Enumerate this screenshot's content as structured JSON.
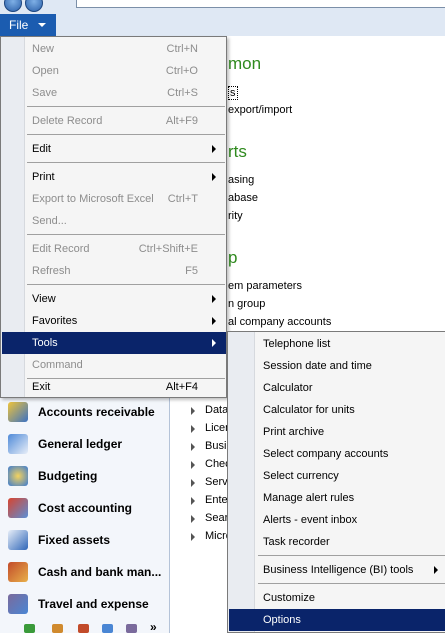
{
  "file_button": {
    "label": "File"
  },
  "background": {
    "headings": [
      "mon",
      "rts",
      "p"
    ],
    "lines": [
      "s",
      "export/import",
      "asing",
      "abase",
      "rity",
      "em parameters",
      "n group",
      "al company accounts"
    ]
  },
  "nav_pane": {
    "items": [
      {
        "label": "Accounts receivable",
        "icon": "accounts-receivable-icon"
      },
      {
        "label": "General ledger",
        "icon": "general-ledger-icon"
      },
      {
        "label": "Budgeting",
        "icon": "budgeting-icon"
      },
      {
        "label": "Cost accounting",
        "icon": "cost-accounting-icon"
      },
      {
        "label": "Fixed assets",
        "icon": "fixed-assets-icon"
      },
      {
        "label": "Cash and bank man...",
        "icon": "cash-and-bank-icon"
      },
      {
        "label": "Travel and expense",
        "icon": "travel-and-expense-icon"
      }
    ],
    "more_glyph": "»"
  },
  "secondary_list": [
    "Data",
    "Licen",
    "Busin",
    "Chec",
    "Serv",
    "Ente",
    "Sear",
    "Micro"
  ],
  "file_menu": {
    "items": [
      {
        "label": "New",
        "shortcut": "Ctrl+N",
        "disabled": true
      },
      {
        "label": "Open",
        "shortcut": "Ctrl+O",
        "disabled": true
      },
      {
        "label": "Save",
        "shortcut": "Ctrl+S",
        "disabled": true
      },
      {
        "label": "Delete Record",
        "shortcut": "Alt+F9",
        "disabled": true
      },
      {
        "label": "Edit",
        "shortcut": "",
        "disabled": false,
        "submenu": true
      },
      {
        "label": "Print",
        "shortcut": "",
        "disabled": false,
        "submenu": true
      },
      {
        "label": "Export to Microsoft Excel",
        "shortcut": "Ctrl+T",
        "disabled": true
      },
      {
        "label": "Send...",
        "shortcut": "",
        "disabled": true
      },
      {
        "label": "Edit Record",
        "shortcut": "Ctrl+Shift+E",
        "disabled": true
      },
      {
        "label": "Refresh",
        "shortcut": "F5",
        "disabled": true
      },
      {
        "label": "View",
        "shortcut": "",
        "disabled": false,
        "submenu": true
      },
      {
        "label": "Favorites",
        "shortcut": "",
        "disabled": false,
        "submenu": true
      },
      {
        "label": "Tools",
        "shortcut": "",
        "disabled": false,
        "submenu": true,
        "highlighted": true
      },
      {
        "label": "Command",
        "shortcut": "",
        "disabled": true
      },
      {
        "label": "Exit",
        "shortcut": "Alt+F4",
        "disabled": false
      }
    ]
  },
  "tools_submenu": {
    "items": [
      {
        "label": "Telephone list"
      },
      {
        "label": "Session date and time"
      },
      {
        "label": "Calculator"
      },
      {
        "label": "Calculator for units"
      },
      {
        "label": "Print archive"
      },
      {
        "label": "Select company accounts"
      },
      {
        "label": "Select currency"
      },
      {
        "label": "Manage alert rules"
      },
      {
        "label": "Alerts - event inbox"
      },
      {
        "label": "Task recorder"
      },
      {
        "label": "Business Intelligence (BI) tools",
        "submenu": true
      },
      {
        "label": "Customize"
      },
      {
        "label": "Options",
        "highlighted": true
      }
    ]
  },
  "colors": {
    "menu_highlight": "#0a246a",
    "file_button": "#1b5cb0",
    "heading_green": "#2f8a1e"
  }
}
